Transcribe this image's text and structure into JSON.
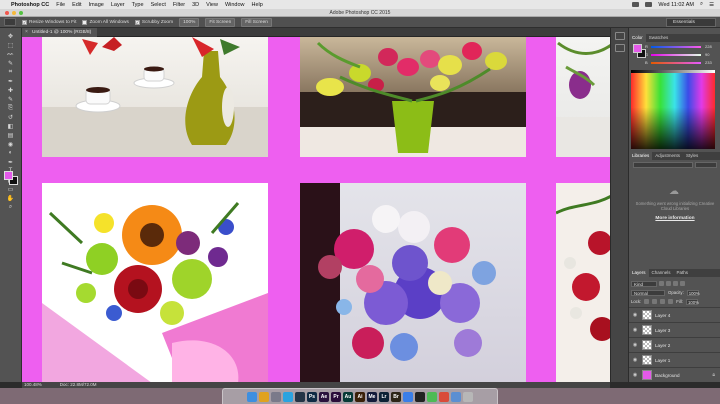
{
  "menubar": {
    "apple": "",
    "app_name": "Photoshop CC",
    "items": [
      "File",
      "Edit",
      "Image",
      "Layer",
      "Type",
      "Select",
      "Filter",
      "3D",
      "View",
      "Window",
      "Help"
    ],
    "clock": "Wed 11:02 AM"
  },
  "titlebar": {
    "title": "Adobe Photoshop CC 2015"
  },
  "options": {
    "resize_windows": "Resize Windows to Fit",
    "zoom_all_windows": "Zoom All Windows",
    "scrubby_zoom": "Scrubby Zoom",
    "zoom_100": "100%",
    "fit_screen": "Fit Screen",
    "fill_screen": "Fill Screen",
    "workspace": "Essentials"
  },
  "document": {
    "tab_label": "Untitled-1 @ 100% (RGB/8)"
  },
  "tools": {
    "icons": [
      "move-tool",
      "marquee-tool",
      "lasso-tool",
      "quick-select-tool",
      "crop-tool",
      "eyedropper-tool",
      "healing-tool",
      "brush-tool",
      "stamp-tool",
      "history-brush-tool",
      "eraser-tool",
      "gradient-tool",
      "blur-tool",
      "dodge-tool",
      "pen-tool",
      "type-tool",
      "path-select-tool",
      "shape-tool",
      "hand-tool",
      "zoom-tool"
    ],
    "glyphs": [
      "✥",
      "⬚",
      "ᨐ",
      "✎",
      "⌗",
      "✒",
      "✚",
      "✎",
      "⎘",
      "↺",
      "◧",
      "▤",
      "◉",
      "◐",
      "✒",
      "T",
      "▶",
      "▭",
      "✋",
      "⌕"
    ],
    "foreground": "#e45ae9",
    "background": "#111111"
  },
  "color_panel": {
    "tabs": [
      "Color",
      "Swatches"
    ],
    "r_label": "R",
    "r_value": "228",
    "g_label": "G",
    "g_value": "90",
    "b_label": "B",
    "b_value": "233"
  },
  "libraries_panel": {
    "tabs": [
      "Libraries",
      "Adjustments",
      "Styles"
    ],
    "message": "Something went wrong initializing Creative Cloud Libraries",
    "link": "More information"
  },
  "layers_panel": {
    "tabs": [
      "Layers",
      "Channels",
      "Paths"
    ],
    "kind_label": "Kind",
    "blend_mode": "Normal",
    "opacity_label": "Opacity:",
    "opacity_value": "100%",
    "lock_label": "Lock:",
    "fill_label": "Fill:",
    "fill_value": "100%",
    "layers": [
      "Layer 4",
      "Layer 3",
      "Layer 2",
      "Layer 1",
      "Background"
    ]
  },
  "statusbar": {
    "zoom": "100.48%",
    "doc": "Doc: 22.8M/72.0M"
  },
  "dock": {
    "apps": [
      {
        "name": "Finder",
        "color": "#3d8fe0",
        "glyph": ""
      },
      {
        "name": "Chrome",
        "color": "#e0a21e",
        "glyph": ""
      },
      {
        "name": "Launchpad",
        "color": "#7a7a8a",
        "glyph": ""
      },
      {
        "name": "Safari",
        "color": "#2aa3e0",
        "glyph": ""
      },
      {
        "name": "Steam",
        "color": "#243446",
        "glyph": ""
      },
      {
        "name": "Photoshop",
        "color": "#0f2a44",
        "glyph": "Ps"
      },
      {
        "name": "After Effects",
        "color": "#29113d",
        "glyph": "Ae"
      },
      {
        "name": "Premiere",
        "color": "#2a0d3a",
        "glyph": "Pr"
      },
      {
        "name": "Audition",
        "color": "#063a36",
        "glyph": "Au"
      },
      {
        "name": "Illustrator",
        "color": "#3a1f07",
        "glyph": "Ai"
      },
      {
        "name": "Media Encoder",
        "color": "#131a3a",
        "glyph": "Me"
      },
      {
        "name": "Lightroom",
        "color": "#0b2135",
        "glyph": "Lr"
      },
      {
        "name": "Bridge",
        "color": "#2c2517",
        "glyph": "Br"
      },
      {
        "name": "App Store",
        "color": "#3a7ee8",
        "glyph": ""
      },
      {
        "name": "Terminal",
        "color": "#222222",
        "glyph": ""
      },
      {
        "name": "Messages",
        "color": "#4dbb55",
        "glyph": ""
      },
      {
        "name": "Screenshot",
        "color": "#d94b3a",
        "glyph": ""
      },
      {
        "name": "Downloads",
        "color": "#5b8fd2",
        "glyph": ""
      },
      {
        "name": "Trash",
        "color": "#b7b7b7",
        "glyph": ""
      }
    ]
  },
  "canvas": {
    "background": "#ee5ff0"
  }
}
